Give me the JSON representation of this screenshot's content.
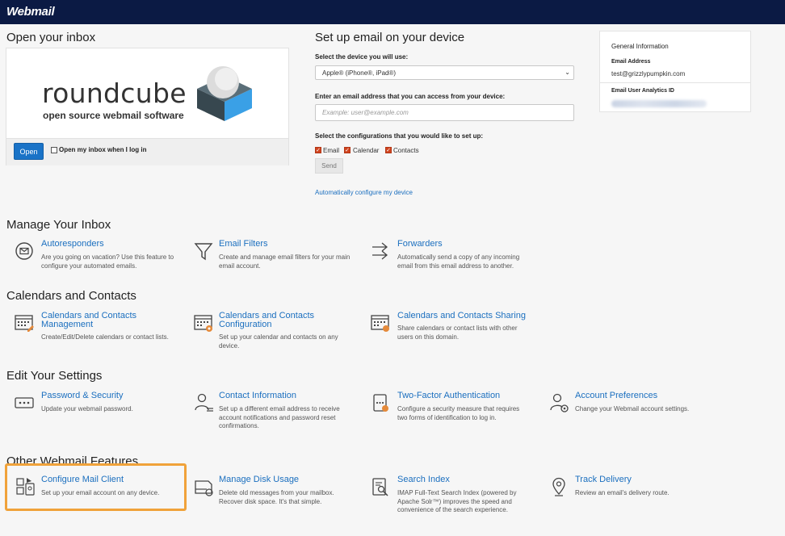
{
  "app": {
    "logo": "Webmail"
  },
  "open_inbox": {
    "heading": "Open your inbox",
    "brand_word": "roundcube",
    "brand_sub": "open source webmail software",
    "open_button": "Open",
    "checkbox_label": "Open my inbox when I log in"
  },
  "setup": {
    "heading": "Set up email on your device",
    "device_label": "Select the device you will use:",
    "device_value": "Apple® (iPhone®, iPad®)",
    "email_label": "Enter an email address that you can access from your device:",
    "email_placeholder": "Example: user@example.com",
    "config_label": "Select the configurations that you would like to set up:",
    "configs": [
      "Email",
      "Calendar",
      "Contacts"
    ],
    "send_button": "Send",
    "auto_link": "Automatically configure my device"
  },
  "general_info": {
    "title": "General Information",
    "email_label": "Email Address",
    "email_value": "test@grizzlypumpkin.com",
    "analytics_label": "Email User Analytics ID"
  },
  "sections": [
    {
      "heading": "Manage Your Inbox",
      "items": [
        {
          "icon": "autoresponder-icon",
          "title": "Autoresponders",
          "title2": "",
          "desc": [
            "Are you going on vacation? Use this feature to",
            "configure your automated emails."
          ]
        },
        {
          "icon": "filter-icon",
          "title": "Email Filters",
          "title2": "",
          "desc": [
            "Create and manage email filters for your main",
            "email account."
          ]
        },
        {
          "icon": "forward-icon",
          "title": "Forwarders",
          "title2": "",
          "desc": [
            "Automatically send a copy of any incoming",
            "email from this email address to another."
          ]
        }
      ]
    },
    {
      "heading": "Calendars and Contacts",
      "items": [
        {
          "icon": "calendar-edit-icon",
          "title": "Calendars and Contacts",
          "title2": "Management",
          "desc": [
            "Create/Edit/Delete calendars or contact lists."
          ]
        },
        {
          "icon": "calendar-config-icon",
          "title": "Calendars and Contacts",
          "title2": "Configuration",
          "desc": [
            "Set up your calendar and contacts on any",
            "device."
          ]
        },
        {
          "icon": "calendar-share-icon",
          "title": "Calendars and Contacts Sharing",
          "title2": "",
          "desc": [
            "Share calendars or contact lists with other",
            "users on this domain."
          ]
        }
      ]
    },
    {
      "heading": "Edit Your Settings",
      "items": [
        {
          "icon": "password-icon",
          "title": "Password & Security",
          "title2": "",
          "desc": [
            "Update your webmail password."
          ]
        },
        {
          "icon": "contact-icon",
          "title": "Contact Information",
          "title2": "",
          "desc": [
            "Set up a different email address to receive",
            "account notifications and password reset",
            "confirmations."
          ]
        },
        {
          "icon": "two-factor-icon",
          "title": "Two-Factor Authentication",
          "title2": "",
          "desc": [
            "Configure a security measure that requires",
            "two forms of identification to log in."
          ]
        },
        {
          "icon": "account-prefs-icon",
          "title": "Account Preferences",
          "title2": "",
          "desc": [
            "Change your Webmail account settings."
          ]
        }
      ]
    },
    {
      "heading": "Other Webmail Features",
      "items": [
        {
          "icon": "mail-client-icon",
          "title": "Configure Mail Client",
          "title2": "",
          "desc": [
            "Set up your email account on any device."
          ]
        },
        {
          "icon": "disk-icon",
          "title": "Manage Disk Usage",
          "title2": "",
          "desc": [
            "Delete old messages from your mailbox.",
            "Recover disk space. It's that simple."
          ]
        },
        {
          "icon": "search-index-icon",
          "title": "Search Index",
          "title2": "",
          "desc": [
            "IMAP Full-Text Search Index (powered by",
            "Apache Solr™) improves the speed and",
            "convenience of the search experience."
          ]
        },
        {
          "icon": "track-delivery-icon",
          "title": "Track Delivery",
          "title2": "",
          "desc": [
            "Review an email's delivery route."
          ]
        }
      ]
    }
  ]
}
